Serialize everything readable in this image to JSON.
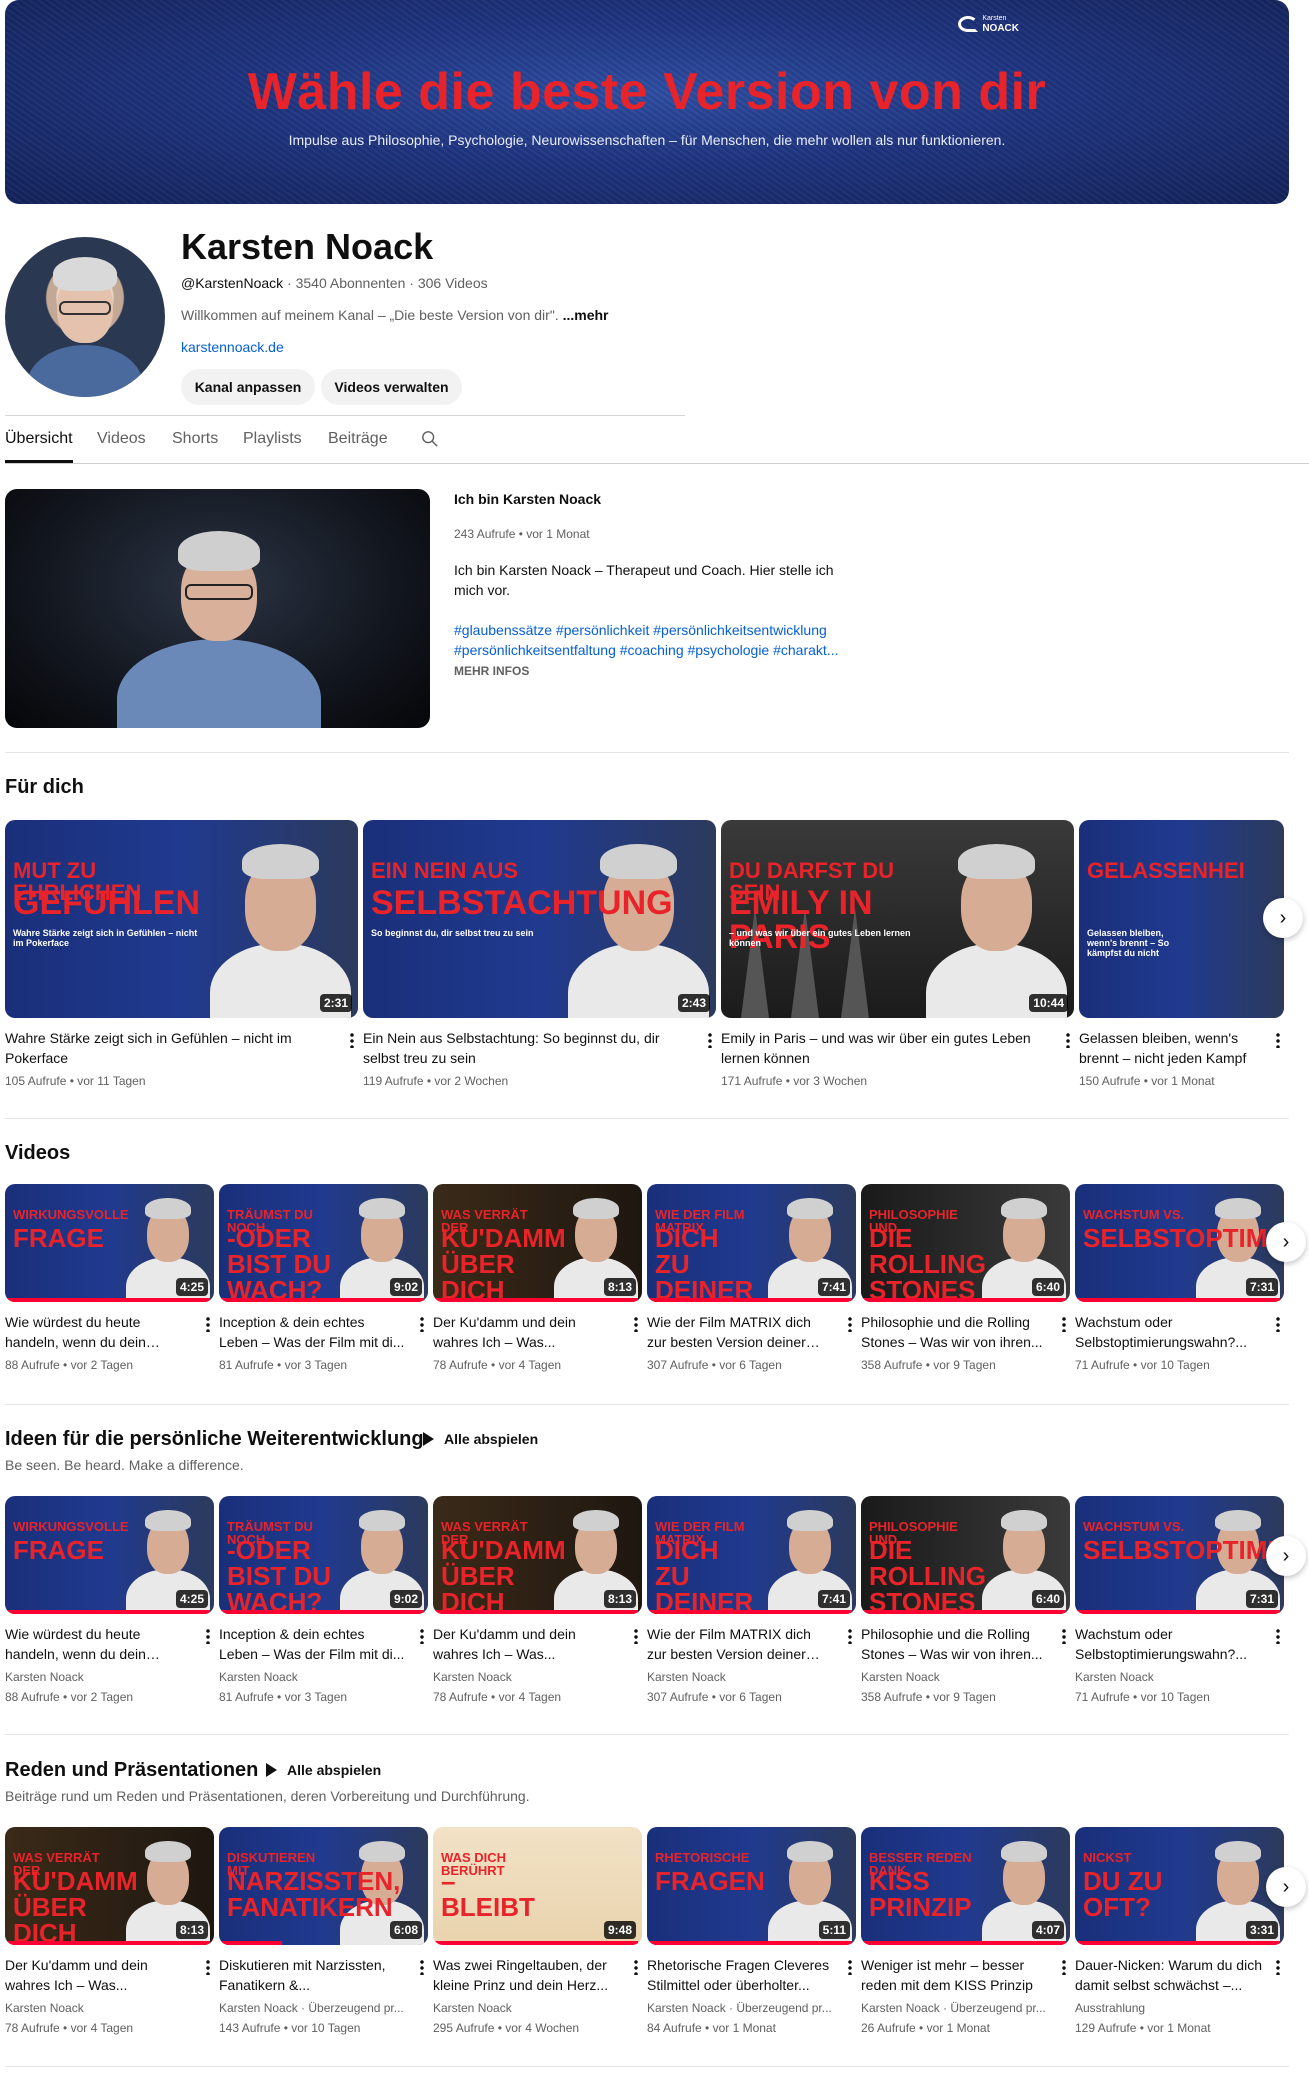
{
  "banner": {
    "title": "Wähle die beste Version von dir",
    "subtitle": "Impulse aus Philosophie, Psychologie, Neurowissenschaften – für Menschen, die mehr wollen als nur funktionieren.",
    "logo_small": "Karsten",
    "logo_big": "NOACK"
  },
  "channel": {
    "name": "Karsten Noack",
    "handle": "@KarstenNoack",
    "stats": " · 3540 Abonnenten · 306 Videos",
    "description": "Willkommen auf meinem Kanal – „Die beste Version von dir\". ",
    "more": "...mehr",
    "link": "karstennoack.de",
    "buttons": {
      "customize": "Kanal anpassen",
      "manage": "Videos verwalten"
    }
  },
  "tabs": [
    "Übersicht",
    "Videos",
    "Shorts",
    "Playlists",
    "Beiträge"
  ],
  "featured": {
    "title": "Ich bin Karsten Noack",
    "meta": "243 Aufrufe • vor 1 Monat",
    "description": "Ich bin Karsten Noack – Therapeut und Coach. Hier stelle ich mich vor.",
    "tags_line1": "#glaubenssätze #persönlichkeit #persönlichkeitsentwicklung",
    "tags_line2": "#persönlichkeitsentfaltung  #coaching #psychologie #charakt...",
    "more": "MEHR INFOS"
  },
  "sections": {
    "fuer_dich": {
      "title": "Für dich",
      "cards": [
        {
          "band": "Mut zu ehrlichen",
          "band2": "Gefühlen",
          "tiny": "Wahre Stärke zeigt sich in Gefühlen – nicht im Pokerface",
          "duration": "2:31",
          "title": "Wahre Stärke zeigt sich in Gefühlen – nicht im Pokerface",
          "meta": "105 Aufrufe • vor 11 Tagen"
        },
        {
          "band": "Ein Nein aus",
          "band2": "Selbstachtung",
          "tiny": "So beginnst du, dir selbst treu zu sein",
          "duration": "2:43",
          "title": "Ein Nein aus Selbstachtung: So beginnst du, dir selbst treu zu sein",
          "meta": "119 Aufrufe • vor 2 Wochen"
        },
        {
          "band": "Du darfst du sein",
          "band2": "Emily in Paris",
          "tiny": "– und was wir über ein gutes Leben lernen können",
          "duration": "10:44",
          "title": "Emily in Paris – und was wir über ein gutes Leben lernen können",
          "meta": "171 Aufrufe • vor 3 Wochen"
        },
        {
          "band": "Gelassenhei",
          "band2": "",
          "tiny": "Gelassen bleiben, wenn's brennt – So kämpfst du nicht",
          "duration": "",
          "title": "Gelassen bleiben, wenn's brennt – nicht jeden Kampf",
          "meta": "150 Aufrufe • vor 1 Monat"
        }
      ]
    },
    "videos": {
      "title": "Videos",
      "cards": [
        {
          "band": "Wirkungsvolle",
          "band2": "Frage",
          "duration": "4:25",
          "title": "Wie würdest du heute handeln, wenn du dein Lebe...",
          "meta": "88 Aufrufe • vor 2 Tagen"
        },
        {
          "band": "Träumst du noch",
          "band2": "-oder bist du wach?",
          "duration": "9:02",
          "title": "Inception & dein echtes Leben – Was der Film mit di...",
          "meta": "81 Aufrufe • vor 3 Tagen"
        },
        {
          "band": "Was verrät der",
          "band2": "Ku'Damm über dich",
          "duration": "8:13",
          "title": "Der Ku'damm und dein wahres Ich – Was...",
          "meta": "78 Aufrufe • vor 4 Tagen"
        },
        {
          "band": "Wie der Film Matrix",
          "band2": "dich zu deiner besten",
          "duration": "7:41",
          "title": "Wie der Film MATRIX dich zur besten Version deiner selbs...",
          "meta": "307 Aufrufe • vor 6 Tagen"
        },
        {
          "band": "Philosophie und",
          "band2": "die Rolling Stones",
          "duration": "6:40",
          "title": "Philosophie und die Rolling Stones – Was wir von ihren...",
          "meta": "358 Aufrufe • vor 9 Tagen"
        },
        {
          "band": "Wachstum vs.",
          "band2": "Selbstoptimierungswahn",
          "duration": "7:31",
          "title": "Wachstum oder Selbstoptimierungswahn?...",
          "meta": "71 Aufrufe • vor 10 Tagen"
        }
      ]
    },
    "ideen": {
      "title": "Ideen für die persönliche Weiterentwicklung",
      "play_all": "Alle abspielen",
      "subtitle": "Be seen. Be heard. Make a difference.",
      "channel": "Karsten Noack",
      "cards": [
        {
          "band": "Wirkungsvolle",
          "band2": "Frage",
          "duration": "4:25",
          "title": "Wie würdest du heute handeln, wenn du dein Lebe...",
          "meta": "88 Aufrufe • vor 2 Tagen"
        },
        {
          "band": "Träumst du noch",
          "band2": "-oder bist du wach?",
          "duration": "9:02",
          "title": "Inception & dein echtes Leben – Was der Film mit di...",
          "meta": "81 Aufrufe • vor 3 Tagen"
        },
        {
          "band": "Was verrät der",
          "band2": "Ku'Damm über dich",
          "duration": "8:13",
          "title": "Der Ku'damm und dein wahres Ich – Was...",
          "meta": "78 Aufrufe • vor 4 Tagen"
        },
        {
          "band": "Wie der Film Matrix",
          "band2": "dich zu deiner besten",
          "duration": "7:41",
          "title": "Wie der Film MATRIX dich zur besten Version deiner selbs...",
          "meta": "307 Aufrufe • vor 6 Tagen"
        },
        {
          "band": "Philosophie und",
          "band2": "die Rolling Stones",
          "duration": "6:40",
          "title": "Philosophie und die Rolling Stones – Was wir von ihren...",
          "meta": "358 Aufrufe • vor 9 Tagen"
        },
        {
          "band": "Wachstum vs.",
          "band2": "Selbstoptimierungswahn",
          "duration": "7:31",
          "title": "Wachstum oder Selbstoptimierungswahn?...",
          "meta": "71 Aufrufe • vor 10 Tagen"
        }
      ]
    },
    "reden": {
      "title": "Reden und Präsentationen",
      "play_all": "Alle abspielen",
      "subtitle": "Beiträge rund um Reden und Präsentationen, deren Vorbereitung und Durchführung.",
      "cards": [
        {
          "band": "Was verrät der",
          "band2": "Ku'Damm über dich",
          "duration": "8:13",
          "title": "Der Ku'damm und dein wahres Ich – Was...",
          "channel": "Karsten Noack",
          "meta": "78 Aufrufe • vor 4 Tagen"
        },
        {
          "band": "Diskutieren mit",
          "band2": "Narzissten, Fanatikern",
          "duration": "6:08",
          "title": "Diskutieren mit Narzissten, Fanatikern &...",
          "channel": "Karsten Noack · Überzeugend pr...",
          "meta": "143 Aufrufe • vor 10 Tagen"
        },
        {
          "band": "Was dich berührt",
          "band2": "– bleibt",
          "duration": "9:48",
          "title": "Was zwei Ringeltauben, der kleine Prinz und dein Herz...",
          "channel": "Karsten Noack",
          "meta": "295 Aufrufe • vor 4 Wochen"
        },
        {
          "band": "Rhetorische",
          "band2": "Fragen",
          "duration": "5:11",
          "title": "Rhetorische Fragen Cleveres Stilmittel oder überholter...",
          "channel": "Karsten Noack · Überzeugend pr...",
          "meta": "84 Aufrufe • vor 1 Monat"
        },
        {
          "band": "Besser reden dank",
          "band2": "Kiss Prinzip",
          "duration": "4:07",
          "title": "Weniger ist mehr – besser reden mit dem KISS Prinzip",
          "channel": "Karsten Noack · Überzeugend pr...",
          "meta": "26 Aufrufe • vor 1 Monat"
        },
        {
          "band": "Nickst",
          "band2": "du zu oft?",
          "duration": "3:31",
          "title": "Dauer-Nicken: Warum du dich damit selbst schwächst –...",
          "channel": "Ausstrahlung",
          "meta": "129 Aufrufe • vor 1 Monat"
        }
      ]
    }
  }
}
